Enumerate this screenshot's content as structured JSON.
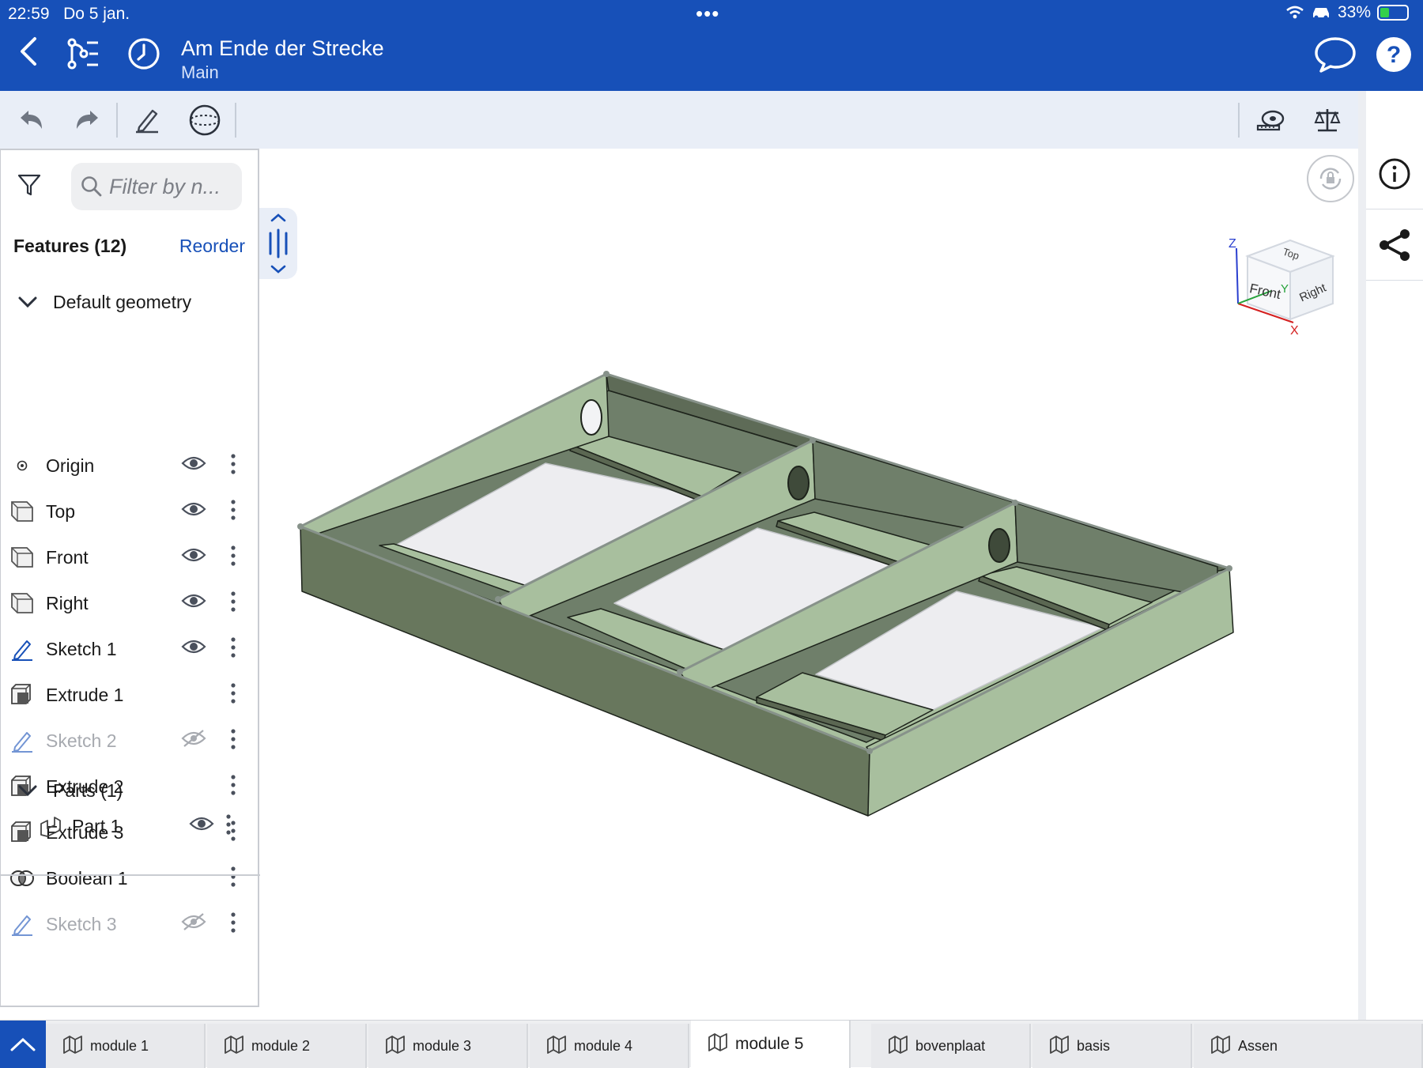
{
  "status": {
    "time": "22:59",
    "date": "Do 5 jan.",
    "battery": "33%",
    "battery_fraction": 0.33
  },
  "header": {
    "title": "Am Ende der Strecke",
    "subtitle": "Main"
  },
  "search": {
    "placeholder": "Filter by n..."
  },
  "features": {
    "heading": "Features (12)",
    "reorder_label": "Reorder",
    "group_default": "Default geometry",
    "items": [
      {
        "label": "Origin",
        "icon": "origin-icon",
        "visible": true
      },
      {
        "label": "Top",
        "icon": "plane-icon",
        "visible": true
      },
      {
        "label": "Front",
        "icon": "plane-icon",
        "visible": true
      },
      {
        "label": "Right",
        "icon": "plane-icon",
        "visible": true
      },
      {
        "label": "Sketch 1",
        "icon": "sketch-icon",
        "visible": true
      },
      {
        "label": "Extrude 1",
        "icon": "extrude-icon",
        "visible": true
      },
      {
        "label": "Sketch 2",
        "icon": "sketch-icon",
        "visible": false
      },
      {
        "label": "Extrude 2",
        "icon": "extrude-icon",
        "visible": true
      },
      {
        "label": "Extrude 3",
        "icon": "extrude-icon",
        "visible": true
      },
      {
        "label": "Boolean 1",
        "icon": "boolean-icon",
        "visible": true
      },
      {
        "label": "Sketch 3",
        "icon": "sketch-icon",
        "visible": false
      }
    ]
  },
  "parts": {
    "heading": "Parts (1)",
    "items": [
      {
        "label": "Part 1"
      }
    ]
  },
  "view_cube": {
    "top": "Top",
    "front": "Front",
    "right": "Right",
    "x": "X",
    "y": "Y",
    "z": "Z"
  },
  "tabs": [
    {
      "label": "module 1",
      "active": false
    },
    {
      "label": "module 2",
      "active": false
    },
    {
      "label": "module 3",
      "active": false
    },
    {
      "label": "module 4",
      "active": false
    },
    {
      "label": "module 5",
      "active": true
    },
    {
      "label": "bovenplaat",
      "active": false
    },
    {
      "label": "basis",
      "active": false
    },
    {
      "label": "Assen",
      "active": false
    }
  ],
  "colors": {
    "brand": "#1750b8",
    "part_face": "#a8bf9e",
    "part_side": "#68775d",
    "part_inner": "#6f7f6a"
  }
}
